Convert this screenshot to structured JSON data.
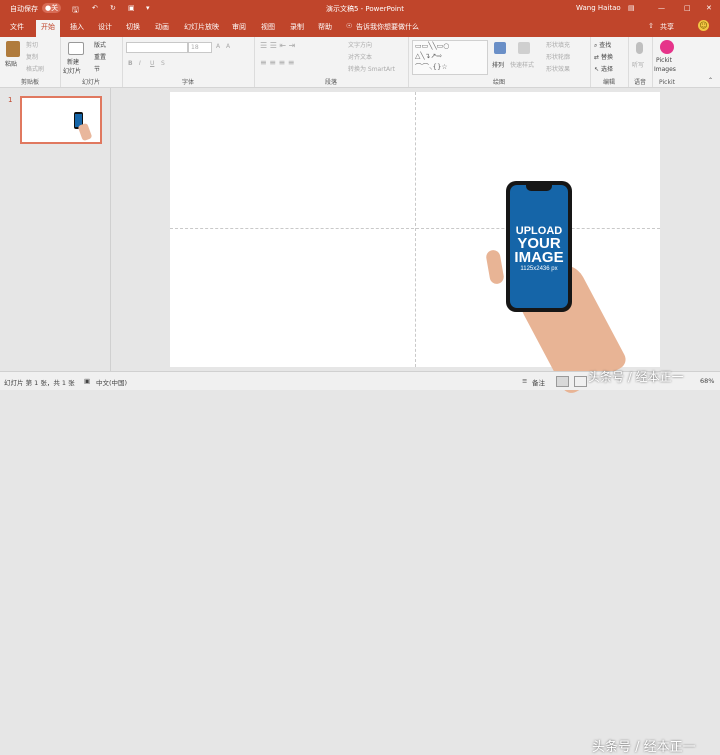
{
  "titlebar": {
    "autosave": "自动保存",
    "autosave_state": "●关",
    "doc_title": "演示文稿5 - PowerPoint",
    "user": "Wang Haitao"
  },
  "tabs": [
    "文件",
    "开始",
    "插入",
    "设计",
    "切换",
    "动画",
    "幻灯片放映",
    "审阅",
    "视图",
    "录制",
    "帮助"
  ],
  "active_tab": "开始",
  "tell_me": "告诉我你想要做什么",
  "share": "共享",
  "ribbon": {
    "clipboard": {
      "paste": "粘贴",
      "cut": "剪切",
      "copy": "复制",
      "format_painter": "格式刷",
      "label": "剪贴板"
    },
    "slides": {
      "new_slide": "新建",
      "new_slide2": "幻灯片",
      "layout": "版式",
      "reset": "重置",
      "section": "节",
      "label": "幻灯片"
    },
    "font": {
      "label": "字体",
      "size": "18",
      "bold": "B",
      "italic": "I",
      "underline": "U",
      "strike": "S",
      "aa": "A"
    },
    "paragraph": {
      "label": "段落",
      "text_direction": "文字方向",
      "align_text": "对齐文本",
      "smartart": "转换为 SmartArt"
    },
    "drawing": {
      "label": "绘图",
      "arrange": "排列",
      "quick_styles": "快速样式",
      "fill": "形状填充",
      "outline": "形状轮廓",
      "effects": "形状效果"
    },
    "editing": {
      "label": "编辑",
      "find": "查找",
      "replace": "替换",
      "select": "选择"
    },
    "voice": {
      "label": "语音",
      "dictate": "听写"
    },
    "pickit": {
      "label": "Pickit",
      "name1": "Pickit",
      "name2": "Images"
    }
  },
  "thumbnail": {
    "number": "1"
  },
  "phone_mockup": {
    "line1": "UPLOAD",
    "line2": "YOUR",
    "line3": "IMAGE",
    "dims": "1125x2436 px"
  },
  "status": {
    "slide_info": "幻灯片 第 1 张，共 1 张",
    "language": "中文(中国)",
    "notes": "备注",
    "zoom": "68%"
  },
  "watermark": "头条号 / 经本正一",
  "colors": {
    "accent": "#c0452b",
    "phone_screen": "#1565a8",
    "ribbon_bg": "#f3f3f3"
  }
}
